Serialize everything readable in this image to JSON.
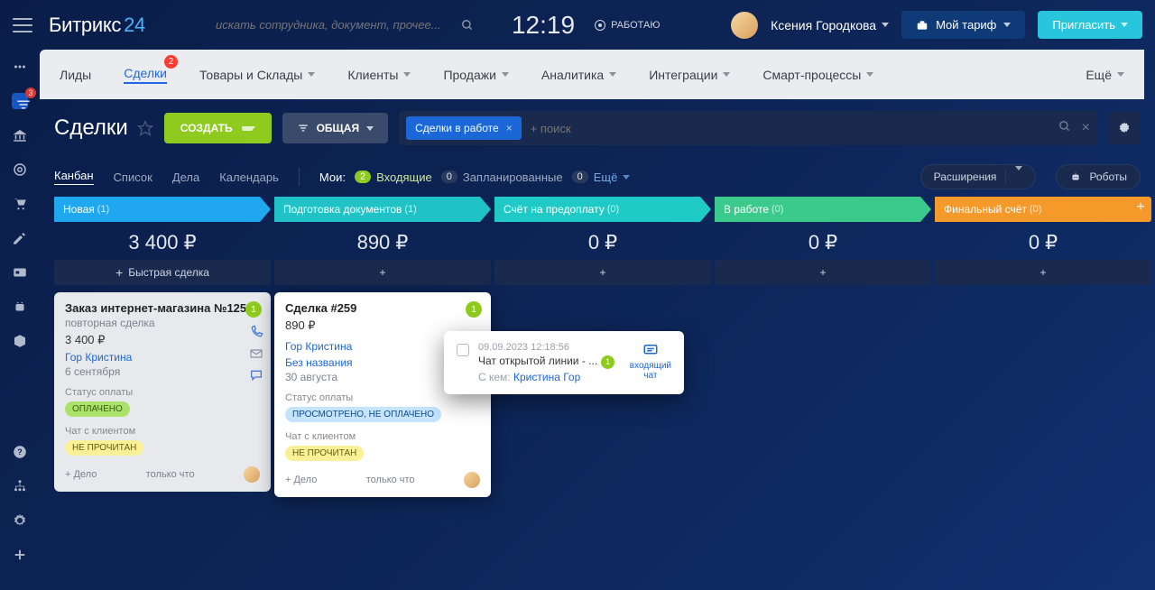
{
  "header": {
    "logo_text": "Битрикс",
    "logo_num": "24",
    "search_placeholder": "искать сотрудника, документ, прочее...",
    "clock": "12:19",
    "work_status": "РАБОТАЮ",
    "user_name": "Ксения Городкова",
    "btn_tariff": "Мой тариф",
    "btn_invite": "Пригласить"
  },
  "left_rail_badge": "3",
  "nav": {
    "leads": "Лиды",
    "deals": "Сделки",
    "deals_badge": "2",
    "products": "Товары и Склады",
    "clients": "Клиенты",
    "sales": "Продажи",
    "analytics": "Аналитика",
    "integrations": "Интеграции",
    "smart": "Смарт-процессы",
    "more": "Ещё"
  },
  "subhead": {
    "title": "Сделки",
    "create": "СОЗДАТЬ",
    "view": "ОБЩАЯ",
    "filter_chip": "Сделки в работе",
    "filter_placeholder": "+ поиск"
  },
  "viewbar": {
    "kanban": "Канбан",
    "list": "Список",
    "deals": "Дела",
    "calendar": "Календарь",
    "my": "Мои:",
    "incoming": "Входящие",
    "incoming_n": "2",
    "planned": "Запланированные",
    "planned_n": "0",
    "more": "Ещё",
    "more_n": "0",
    "ext": "Расширения",
    "robots": "Роботы"
  },
  "columns": [
    {
      "name": "Новая",
      "count": "(1)",
      "sum": "3 400 ₽",
      "color": "blue",
      "quick": "Быстрая сделка"
    },
    {
      "name": "Подготовка документов",
      "count": "(1)",
      "sum": "890 ₽",
      "color": "teal"
    },
    {
      "name": "Счёт на предоплату",
      "count": "(0)",
      "sum": "0 ₽",
      "color": "teal2"
    },
    {
      "name": "В работе",
      "count": "(0)",
      "sum": "0 ₽",
      "color": "green"
    },
    {
      "name": "Финальный счёт",
      "count": "(0)",
      "sum": "0 ₽",
      "color": "orange"
    }
  ],
  "card1": {
    "title": "Заказ интернет-магазина №125",
    "sub": "повторная сделка",
    "price": "3 400 ₽",
    "contact": "Гор Кристина",
    "date": "6 сентября",
    "pay_label": "Статус оплаты",
    "pay_tag": "ОПЛАЧЕНО",
    "chat_label": "Чат с клиентом",
    "chat_tag": "НЕ ПРОЧИТАН",
    "add_deal": "+ Дело",
    "time": "только что",
    "badge": "1"
  },
  "card2": {
    "title": "Сделка #259",
    "price": "890 ₽",
    "contact": "Гор Кристина",
    "subject": "Без названия",
    "date": "30 августа",
    "pay_label": "Статус оплаты",
    "pay_tag": "ПРОСМОТРЕНО, НЕ ОПЛАЧЕНО",
    "chat_label": "Чат с клиентом",
    "chat_tag": "НЕ ПРОЧИТАН",
    "add_deal": "+ Дело",
    "time": "только что",
    "badge": "1"
  },
  "popup": {
    "time": "09.09.2023 12:18:56",
    "title": "Чат открытой линии - ...",
    "badge": "1",
    "with_label": "С кем:",
    "with_name": "Кристина Гор",
    "side_l1": "входящий",
    "side_l2": "чат"
  }
}
